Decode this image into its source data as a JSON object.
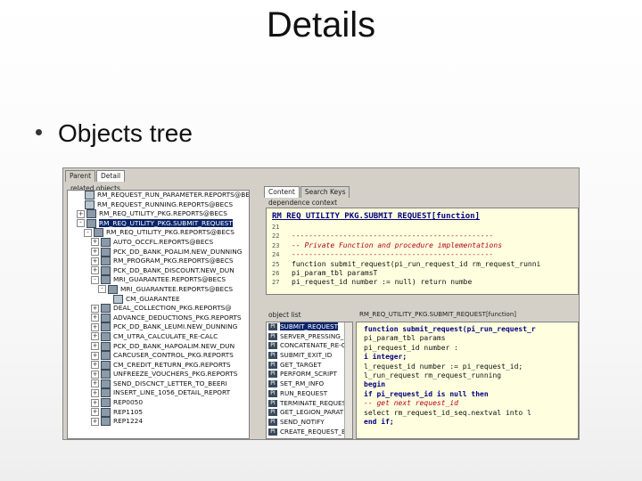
{
  "slide": {
    "title": "Details",
    "bullet": "Objects tree"
  },
  "top_tabs": [
    "Parent",
    "Detail"
  ],
  "tree": {
    "group_label": "related objects",
    "rows": [
      {
        "label": "RM_REQUEST_RUN_PARAMETER.REPORTS@BECS",
        "indent": 1,
        "exp": "",
        "icon": "table-icon"
      },
      {
        "label": "RM_REQUEST_RUNNING.REPORTS@BECS",
        "indent": 1,
        "exp": "",
        "icon": "table-icon"
      },
      {
        "label": "RM_REQ_UTILITY_PKG.REPORTS@BECS",
        "indent": 1,
        "exp": "+",
        "icon": "package-icon"
      },
      {
        "label": "RM_REQ_UTILITY_PKG.SUBMIT_REQUEST",
        "indent": 1,
        "exp": "-",
        "icon": "package-icon",
        "selected": true
      },
      {
        "label": "RM_REQ_UTILITY_PKG.REPORTS@BECS",
        "indent": 2,
        "exp": "-",
        "icon": "package-icon"
      },
      {
        "label": "AUTO_OCCFL.REPORTS@BECS",
        "indent": 3,
        "exp": "+",
        "icon": "package-icon"
      },
      {
        "label": "PCK_DD_BANK_POALIM.NEW_DUNNING",
        "indent": 3,
        "exp": "+",
        "icon": "package-icon"
      },
      {
        "label": "RM_PROGRAM_PKG.REPORTS@BECS",
        "indent": 3,
        "exp": "+",
        "icon": "package-icon"
      },
      {
        "label": "PCK_DD_BANK_DISCOUNT.NEW_DUN",
        "indent": 3,
        "exp": "+",
        "icon": "package-icon"
      },
      {
        "label": "MRI_GUARANTEE.REPORTS@BECS",
        "indent": 3,
        "exp": "-",
        "icon": "package-icon"
      },
      {
        "label": "MRI_GUARANTEE.REPORTS@BECS",
        "indent": 4,
        "exp": "-",
        "icon": "package-icon"
      },
      {
        "label": "CM_GUARANTEE",
        "indent": 5,
        "exp": "",
        "icon": "table-icon"
      },
      {
        "label": "DEAL_COLLECTION_PKG.REPORTS@",
        "indent": 3,
        "exp": "+",
        "icon": "package-icon"
      },
      {
        "label": "ADVANCE_DEDUCTIONS_PKG.REPORTS",
        "indent": 3,
        "exp": "+",
        "icon": "package-icon"
      },
      {
        "label": "PCK_DD_BANK_LEUMI.NEW_DUNNING",
        "indent": 3,
        "exp": "+",
        "icon": "package-icon"
      },
      {
        "label": "CM_UTRA_CALCULATE_RE-CALC",
        "indent": 3,
        "exp": "+",
        "icon": "package-icon"
      },
      {
        "label": "PCK_DD_BANK_HAPOALIM.NEW_DUN",
        "indent": 3,
        "exp": "+",
        "icon": "package-icon"
      },
      {
        "label": "CARCUSER_CONTROL_PKG.REPORTS",
        "indent": 3,
        "exp": "+",
        "icon": "package-icon"
      },
      {
        "label": "CM_CREDIT_RETURN_PKG.REPORTS",
        "indent": 3,
        "exp": "+",
        "icon": "package-icon"
      },
      {
        "label": "UNFREEZE_VOUCHERS_PKG.REPORTS",
        "indent": 3,
        "exp": "+",
        "icon": "package-icon"
      },
      {
        "label": "SEND_DISCNCT_LETTER_TO_BEERI",
        "indent": 3,
        "exp": "+",
        "icon": "package-icon"
      },
      {
        "label": "INSERT_LINE_1056_DETAIL_REPORT",
        "indent": 3,
        "exp": "+",
        "icon": "package-icon"
      },
      {
        "label": "REP0050",
        "indent": 3,
        "exp": "+",
        "icon": "package-icon"
      },
      {
        "label": "REP1105",
        "indent": 3,
        "exp": "+",
        "icon": "package-icon"
      },
      {
        "label": "REP1224",
        "indent": 3,
        "exp": "+",
        "icon": "package-icon"
      }
    ]
  },
  "content_tabs": [
    "Content",
    "Search Keys"
  ],
  "dependence": {
    "group_label": "dependence context",
    "header": "RM_REQ_UTILITY_PKG.SUBMIT_REQUEST[function]",
    "lines": [
      {
        "n": "21",
        "text": "",
        "kind": ""
      },
      {
        "n": "22",
        "text": "-----------------------------------------------",
        "kind": "comment"
      },
      {
        "n": "23",
        "text": "-- Private Function and procedure implementations",
        "kind": "comment"
      },
      {
        "n": "24",
        "text": "-----------------------------------------------",
        "kind": "comment"
      },
      {
        "n": "25",
        "text": "function submit_request(pi_run_request_id  rm_request_runni",
        "kind": "mixed"
      },
      {
        "n": "26",
        "text": "                  pi_param_tbl     paramsT",
        "kind": ""
      },
      {
        "n": "27",
        "text": "                  pi_request_id    number := null) return numbe",
        "kind": ""
      }
    ]
  },
  "object_list": {
    "group_label": "object list",
    "items": [
      {
        "type": "PI",
        "label": "SUBMIT_REQUEST",
        "selected": true
      },
      {
        "type": "PI",
        "label": "SERVER_PRESSING_S"
      },
      {
        "type": "PI",
        "label": "CONCATENATE_RE-C"
      },
      {
        "type": "PI",
        "label": "SUBMIT_EXIT_ID"
      },
      {
        "type": "PI",
        "label": "GET_TARGET"
      },
      {
        "type": "PI",
        "label": "PERFORM_SCRIPT"
      },
      {
        "type": "PI",
        "label": "SET_RM_INFO"
      },
      {
        "type": "PI",
        "label": "RUN_REQUEST"
      },
      {
        "type": "PI",
        "label": "TERMINATE_REQUEST"
      },
      {
        "type": "PI",
        "label": "GET_LEGION_PARAT"
      },
      {
        "type": "PI",
        "label": "SEND_NOTIFY"
      },
      {
        "type": "PI",
        "label": "CREATE_REQUEST_E"
      }
    ]
  },
  "code_panel": {
    "group_label": "RM_REQ_UTILITY_PKG.SUBMIT_REQUEST[function]",
    "lines": [
      "function submit_request(pi_run_request_r",
      "               pi_param_tbl      params",
      "               pi_request_id     number :",
      "   i           integer;",
      "   l_request_id   number := pi_request_id;",
      "   l_run_request  rm_request_running",
      "begin",
      "   if pi_request_id is null then",
      "     -- get next request_id",
      "     select rm_request_id_seq.nextval into l",
      "   end if;"
    ]
  }
}
